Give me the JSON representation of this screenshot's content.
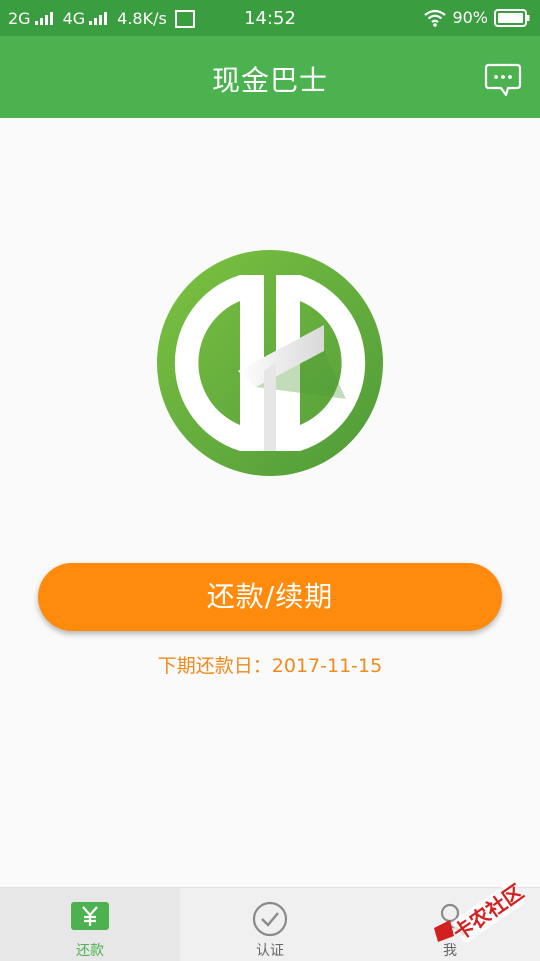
{
  "status_bar": {
    "network1": "2G",
    "network2": "4G",
    "speed": "4.8K/s",
    "time": "14:52",
    "battery": "90%"
  },
  "app_bar": {
    "title": "现金巴士",
    "message_icon": "chat-bubble-icon"
  },
  "main": {
    "logo_icon": "cash-bus-logo",
    "primary_button_label": "还款/续期",
    "next_due_label": "下期还款日：",
    "next_due_date": "2017-11-15"
  },
  "tabs": [
    {
      "label": "还款",
      "icon": "yuan-icon",
      "active": true
    },
    {
      "label": "认证",
      "icon": "check-circle-icon",
      "active": false
    },
    {
      "label": "我",
      "icon": "person-icon",
      "active": false
    }
  ],
  "watermark": {
    "text": "卡农社区"
  },
  "colors": {
    "primary_green": "#4cb24f",
    "status_green": "#3a9d3f",
    "accent_orange": "#ff8a0b",
    "date_orange": "#f08a1c"
  }
}
